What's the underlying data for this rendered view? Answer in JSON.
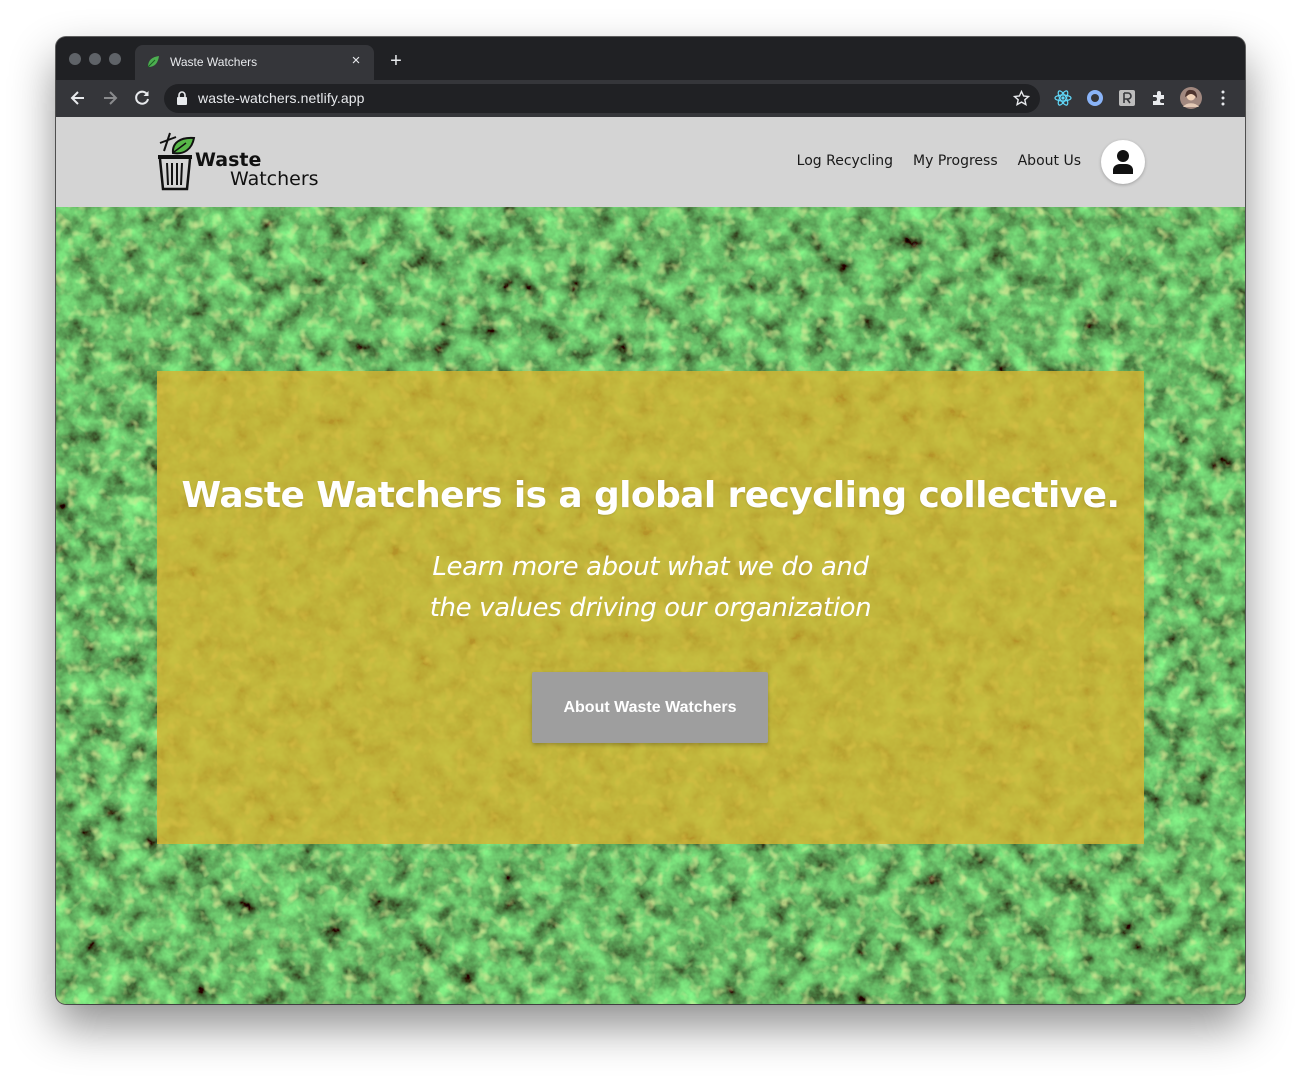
{
  "browser": {
    "tab_title": "Waste Watchers",
    "tab_close": "×",
    "new_tab": "+",
    "url": "waste-watchers.netlify.app"
  },
  "site": {
    "logo_word1": "Waste",
    "logo_word2": "Watchers",
    "nav": [
      "Log Recycling",
      "My Progress",
      "About Us"
    ]
  },
  "hero": {
    "title": "Waste Watchers is a global recycling collective.",
    "subtitle_line1": "Learn more about what we do and",
    "subtitle_line2": "the values driving our organization",
    "button_label": "About Waste Watchers"
  },
  "colors": {
    "header_bg": "#d4d4d4",
    "overlay": "#d6b432",
    "button_bg": "#9e9e9e",
    "browser_chrome": "#202124"
  }
}
